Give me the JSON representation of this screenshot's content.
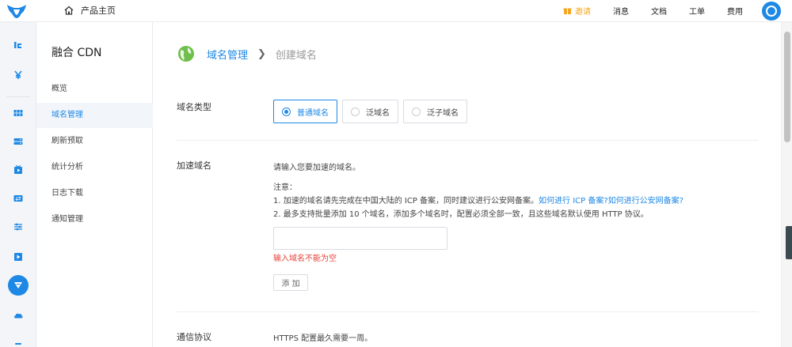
{
  "topbar": {
    "home_label": "产品主页",
    "nav": [
      "邀请",
      "消息",
      "文档",
      "工单",
      "费用"
    ]
  },
  "rail": {
    "icons": [
      "logo-ie-icon",
      "yen-icon",
      "grid-icon",
      "storage-icon",
      "media-icon",
      "transfer-icon",
      "sliders-icon",
      "play-icon",
      "cdn-icon",
      "cloud-icon"
    ]
  },
  "sidebar": {
    "title": "融合 CDN",
    "items": [
      "概览",
      "域名管理",
      "刷新预取",
      "统计分析",
      "日志下载",
      "通知管理"
    ],
    "active_index": 1
  },
  "breadcrumb": {
    "parent": "域名管理",
    "current": "创建域名"
  },
  "form": {
    "domain_type": {
      "label": "域名类型",
      "options": [
        "普通域名",
        "泛域名",
        "泛子域名"
      ],
      "selected": "普通域名"
    },
    "domain": {
      "label": "加速域名",
      "hint": "请输入您要加速的域名。",
      "note_title": "注意：",
      "note1": "1. 加速的域名请先完成在中国大陆的 ICP 备案，同时建议进行公安网备案。",
      "link_icp": "如何进行 ICP 备案?",
      "link_police": "如何进行公安网备案?",
      "note2": "2. 最多支持批量添加 10 个域名，添加多个域名时，配置必须全部一致，且这些域名默认使用 HTTP 协议。",
      "input_value": "",
      "error": "输入域名不能为空",
      "add_label": "添 加"
    },
    "protocol": {
      "label": "通信协议",
      "hint": "HTTPS 配置最久需要一周。"
    }
  },
  "colors": {
    "accent": "#1e88e5",
    "error": "#e5433c",
    "invite": "#f5a623"
  }
}
